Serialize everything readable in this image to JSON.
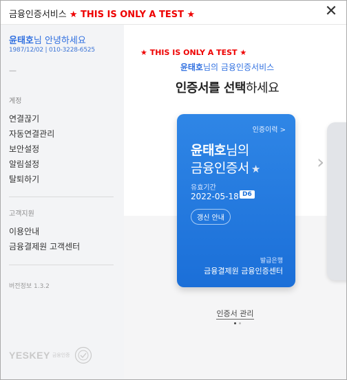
{
  "window": {
    "title": "금융인증서비스",
    "test_badge": "★ THIS IS ONLY A TEST ★",
    "close_glyph": "✕"
  },
  "sidebar": {
    "user_name": "윤태호",
    "greeting_suffix": "님 안녕하세요",
    "user_info": "1987/12/02 | 010-3228-6525",
    "dash": "—",
    "account_label": "계정",
    "account_items": [
      "연결끊기",
      "자동연결관리",
      "보안설정",
      "알림설정",
      "탈퇴하기"
    ],
    "support_label": "고객지원",
    "support_items": [
      "이용안내",
      "금융결제원 고객센터"
    ],
    "version": "버전정보 1.3.2",
    "logo_brand": "YESKEY",
    "logo_sub": "금융인증"
  },
  "main": {
    "test_badge": "★ THIS IS ONLY A TEST ★",
    "user_name": "윤태호",
    "service_suffix": "님의 금융인증서비스",
    "heading_bold": "인증서를 선택",
    "heading_rest": "하세요",
    "card": {
      "history_link": "인증이력 >",
      "owner_name": "윤태호",
      "owner_suffix": "님의",
      "cert_name": "금융인증서",
      "star": "★",
      "validity_label": "유효기간",
      "validity_date": "2022-05-18",
      "dday_badge": "D6",
      "renew_button": "갱신 안내",
      "issuer_label": "발급은행",
      "issuer": "금융결제원 금융인증센터"
    },
    "next_arrow": "›",
    "manage_link": "인증서 관리",
    "page_indicator": {
      "current": 1,
      "total": 2
    }
  },
  "colors": {
    "accent_blue": "#2f6fe0",
    "card_blue": "#1b6fd8",
    "test_red": "#e00000"
  }
}
